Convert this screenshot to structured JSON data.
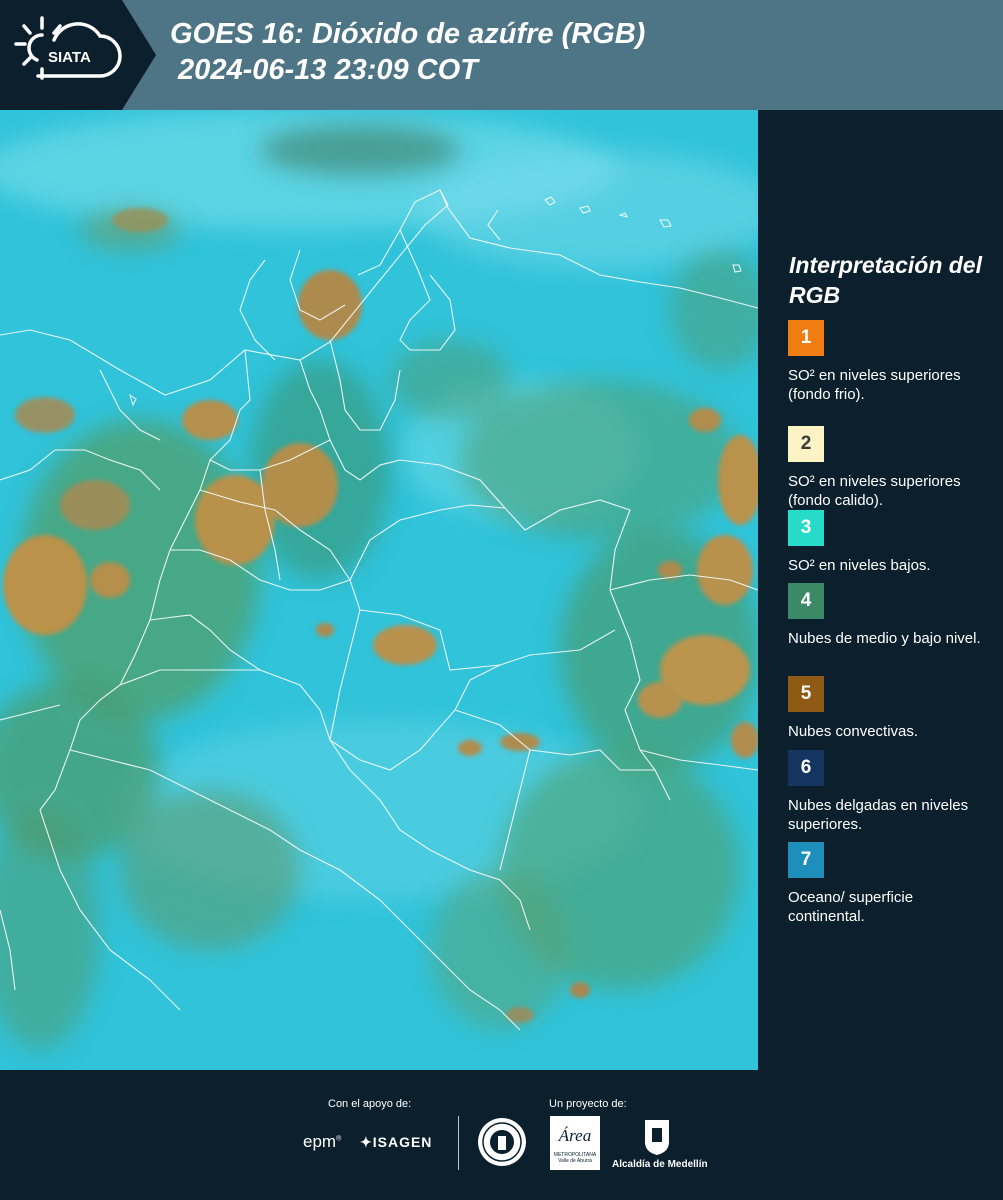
{
  "header": {
    "title_line1": "GOES 16: Dióxido de azúfre (RGB)",
    "title_line2": " 2024-06-13 23:09 COT",
    "logo_text": "SIATA"
  },
  "legend": {
    "title": "Interpretación del RGB",
    "items": [
      {
        "number": "1",
        "color": "#f07d12",
        "text": "SO² en niveles superiores (fondo frio)."
      },
      {
        "number": "2",
        "color": "#fbf3c4",
        "text": "SO² en niveles superiores (fondo calido)."
      },
      {
        "number": "3",
        "color": "#26dbc7",
        "text": "SO² en niveles bajos."
      },
      {
        "number": "4",
        "color": "#3c8a65",
        "text": "Nubes de medio y bajo nivel."
      },
      {
        "number": "5",
        "color": "#8e5a16",
        "text": "Nubes convectivas."
      },
      {
        "number": "6",
        "color": "#143560",
        "text": "Nubes delgadas en niveles superiores."
      },
      {
        "number": "7",
        "color": "#1e8fbb",
        "text": "Oceano/ superficie continental."
      }
    ]
  },
  "footer": {
    "support_label": "Con el apoyo de:",
    "project_label": "Un proyecto de:",
    "sponsor_epm": "epm",
    "sponsor_isagen": "ISAGEN",
    "sponsor_area_line1": "Área",
    "sponsor_area_line2": "METROPOLITANA",
    "sponsor_area_line3": "Valle de Aburrá",
    "sponsor_alcaldia": "Alcaldía de Medellín"
  },
  "colors": {
    "background": "#0b1f2d",
    "header": "#4d7585",
    "map_cyan": "#2fc2d8",
    "map_green": "#4a9a6e",
    "map_convective": "#b7924c"
  }
}
